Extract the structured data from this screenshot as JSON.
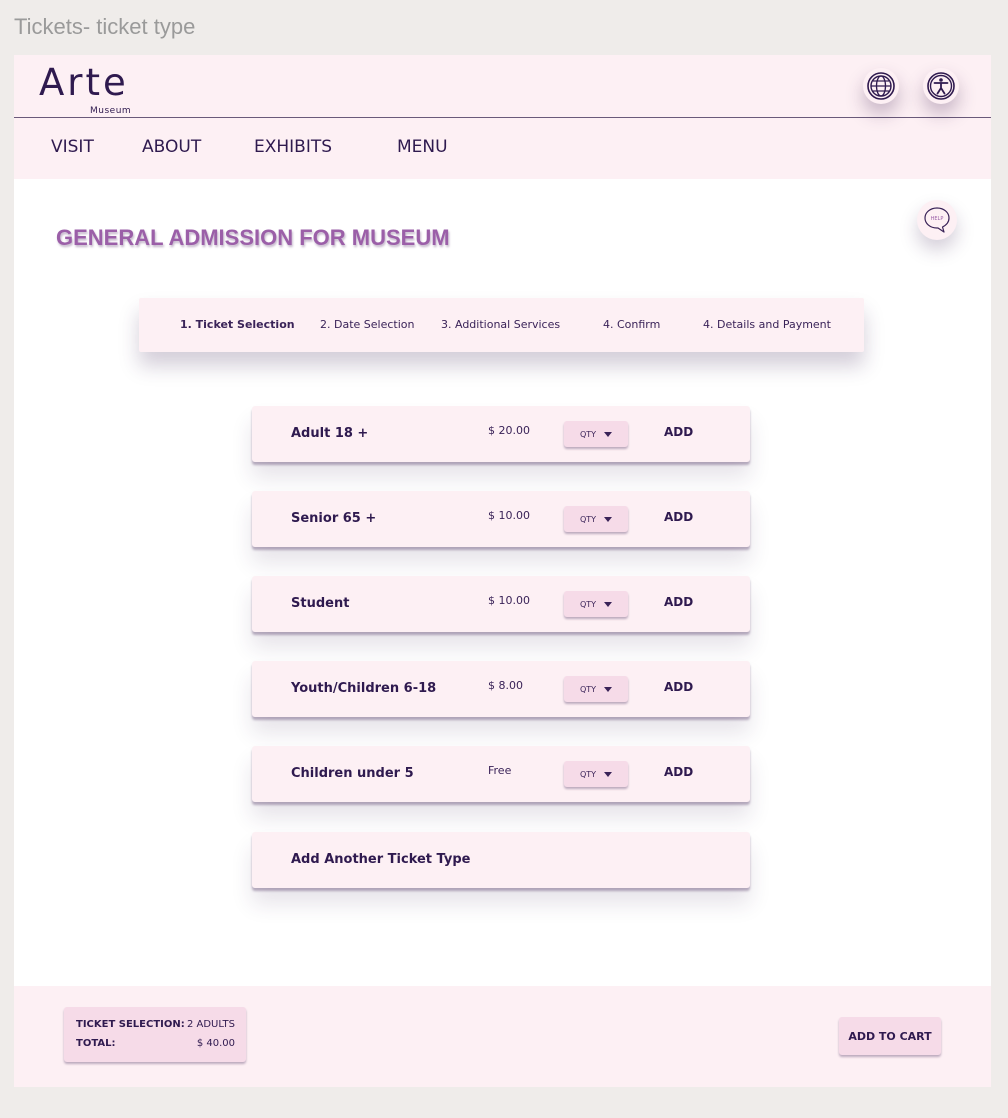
{
  "frame_label": "Tickets- ticket type",
  "header": {
    "logo_main": "Arte",
    "logo_sub": "Museum",
    "language_icon": "globe-icon",
    "accessibility_icon": "accessibility-icon"
  },
  "nav": {
    "items": [
      "VISIT",
      "ABOUT",
      "EXHIBITS",
      "MENU"
    ]
  },
  "help": {
    "label": "HELP",
    "icon": "chat-bubble-icon"
  },
  "page_title": "GENERAL ADMISSION FOR MUSEUM",
  "steps": [
    {
      "label": "1. Ticket Selection",
      "active": true
    },
    {
      "label": "2. Date Selection",
      "active": false
    },
    {
      "label": "3. Additional Services",
      "active": false
    },
    {
      "label": "4. Confirm",
      "active": false
    },
    {
      "label": "4. Details and Payment",
      "active": false
    }
  ],
  "tickets": [
    {
      "name": "Adult 18 +",
      "price": "$ 20.00",
      "qty_label": "QTY",
      "add_label": "ADD"
    },
    {
      "name": "Senior 65 +",
      "price": "$ 10.00",
      "qty_label": "QTY",
      "add_label": "ADD"
    },
    {
      "name": "Student",
      "price": "$ 10.00",
      "qty_label": "QTY",
      "add_label": "ADD"
    },
    {
      "name": "Youth/Children 6-18",
      "price": "$ 8.00",
      "qty_label": "QTY",
      "add_label": "ADD"
    },
    {
      "name": "Children under 5",
      "price": "Free",
      "qty_label": "QTY",
      "add_label": "ADD"
    }
  ],
  "add_another": "Add Another Ticket Type",
  "footer": {
    "selection_label": "TICKET SELECTION:",
    "selection_value": "2 ADULTS",
    "total_label": "TOTAL:",
    "total_value": "$ 40.00",
    "cart_button": "ADD TO CART"
  },
  "colors": {
    "accent": "#9b5fa8",
    "text_dark": "#2f1a4f",
    "panel_pink": "#fdf0f4",
    "button_pink": "#f6dbe8"
  }
}
